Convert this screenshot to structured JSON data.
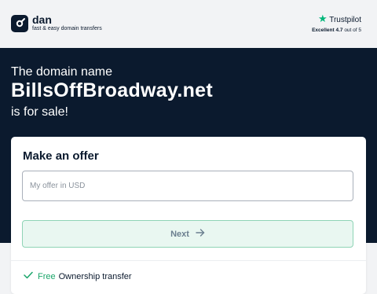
{
  "header": {
    "brand_name": "dan",
    "brand_tagline": "fast & easy domain transfers",
    "trustpilot": {
      "label": "Trustpilot",
      "rating_word": "Excellent",
      "score": "4.7",
      "out_of": "out of 5"
    }
  },
  "hero": {
    "line1": "The domain name",
    "domain": "BillsOffBroadway.net",
    "line3": "is for sale!"
  },
  "offer_card": {
    "title": "Make an offer",
    "input_placeholder": "My offer in USD",
    "input_value": "",
    "next_label": "Next",
    "feature": {
      "free": "Free",
      "text": "Ownership transfer"
    }
  },
  "colors": {
    "navy": "#0b1a2e",
    "accent_green": "#1aa56a",
    "trustpilot_green": "#00b67a",
    "next_bg": "#e9f7f1"
  },
  "icons": [
    "dan-logo-icon",
    "trustpilot-star-icon",
    "arrow-right-icon",
    "check-icon"
  ]
}
